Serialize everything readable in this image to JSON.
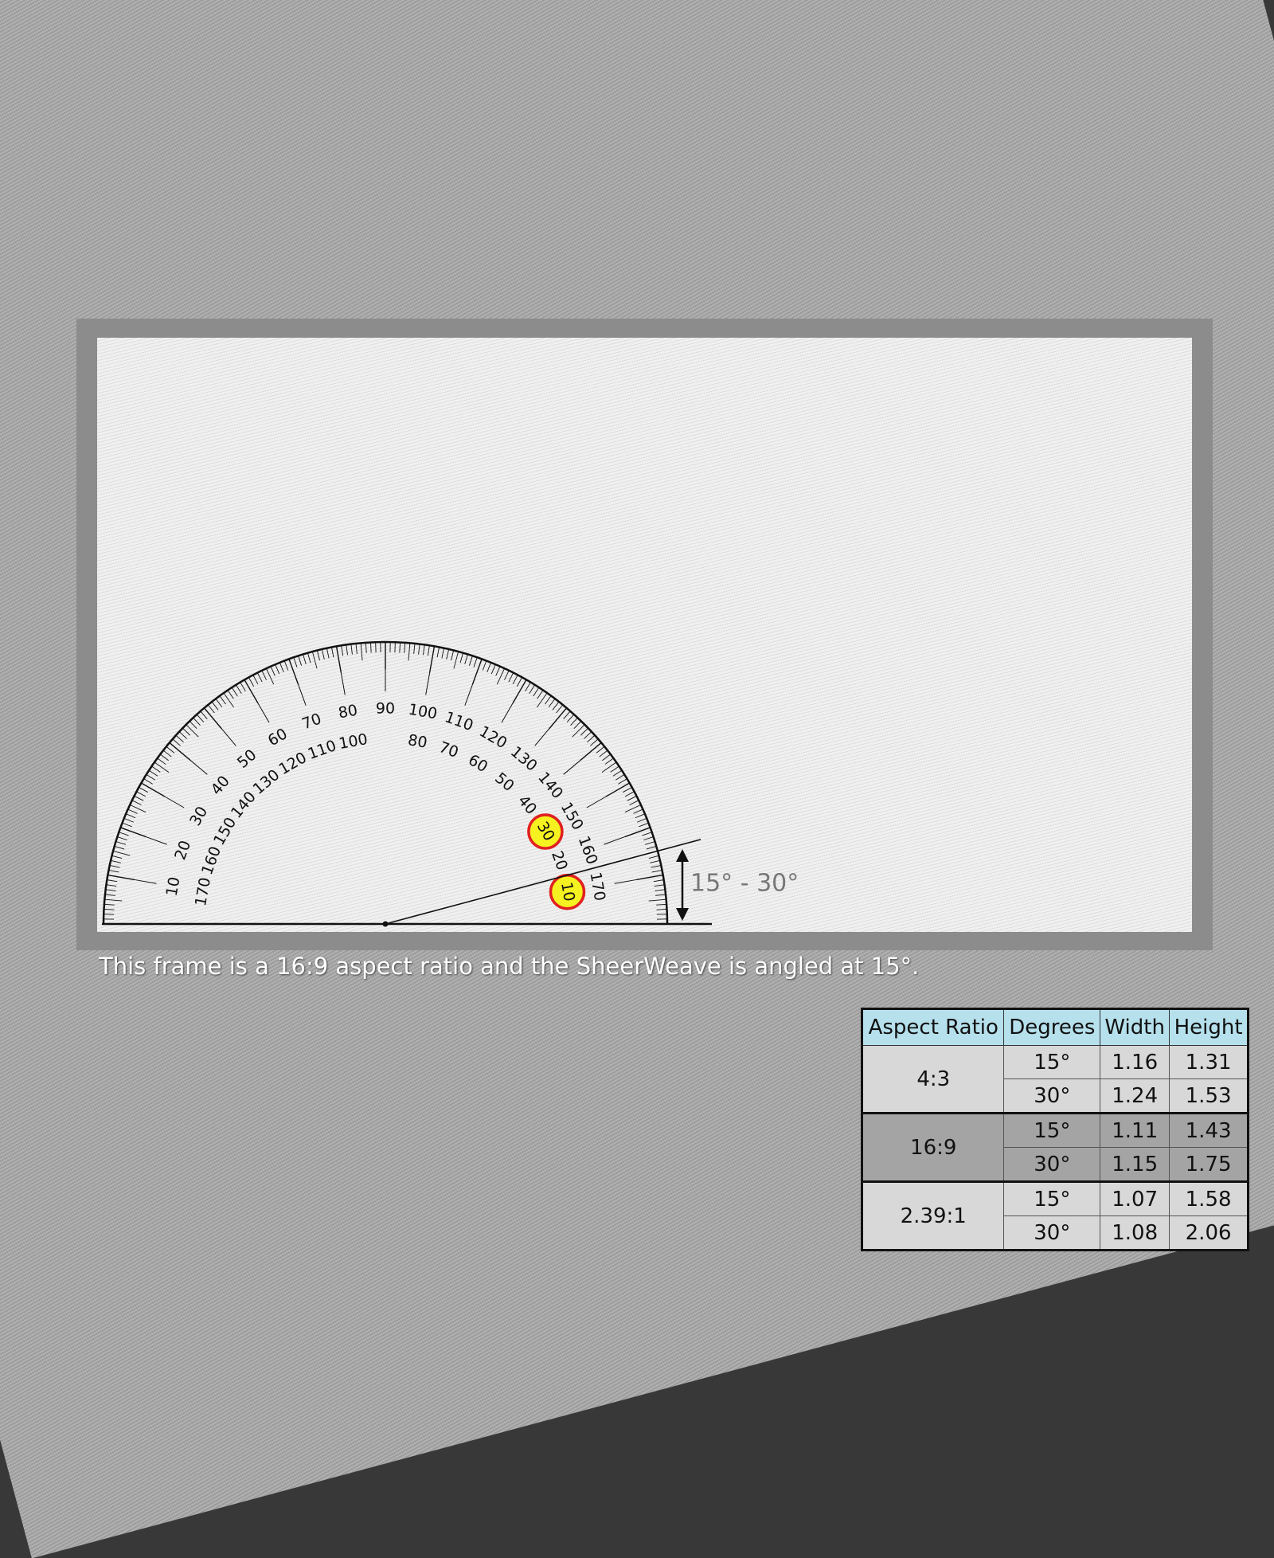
{
  "diagram": {
    "scale_outer": [
      "10",
      "20",
      "30",
      "40",
      "50",
      "60",
      "70",
      "80",
      "90",
      "100",
      "110",
      "120",
      "130",
      "140",
      "150",
      "160",
      "170"
    ],
    "scale_inner": [
      "170",
      "160",
      "150",
      "140",
      "130",
      "120",
      "110",
      "100",
      "80",
      "70",
      "60",
      "50",
      "40",
      "30",
      "20",
      "10"
    ],
    "highlighted_marks": [
      "30",
      "10"
    ],
    "highlight_fill": "#f6f120",
    "highlight_stroke": "#e02020",
    "measured_angle_deg": 15,
    "angle_annotation": "15° - 30°"
  },
  "caption": "This frame is a 16:9 aspect ratio and the SheerWeave is angled at 15°.",
  "table": {
    "headers": [
      "Aspect Ratio",
      "Degrees",
      "Width",
      "Height"
    ],
    "groups": [
      {
        "ratio": "4:3",
        "rows": [
          {
            "degrees": "15°",
            "width": "1.16",
            "height": "1.31"
          },
          {
            "degrees": "30°",
            "width": "1.24",
            "height": "1.53"
          }
        ]
      },
      {
        "ratio": "16:9",
        "rows": [
          {
            "degrees": "15°",
            "width": "1.11",
            "height": "1.43"
          },
          {
            "degrees": "30°",
            "width": "1.15",
            "height": "1.75"
          }
        ]
      },
      {
        "ratio": "2.39:1",
        "rows": [
          {
            "degrees": "15°",
            "width": "1.07",
            "height": "1.58"
          },
          {
            "degrees": "30°",
            "width": "1.08",
            "height": "2.06"
          }
        ]
      }
    ],
    "colors": {
      "header": "#b5e0ec",
      "light_row": "#d8d8d8",
      "dark_row": "#a4a4a4"
    }
  }
}
